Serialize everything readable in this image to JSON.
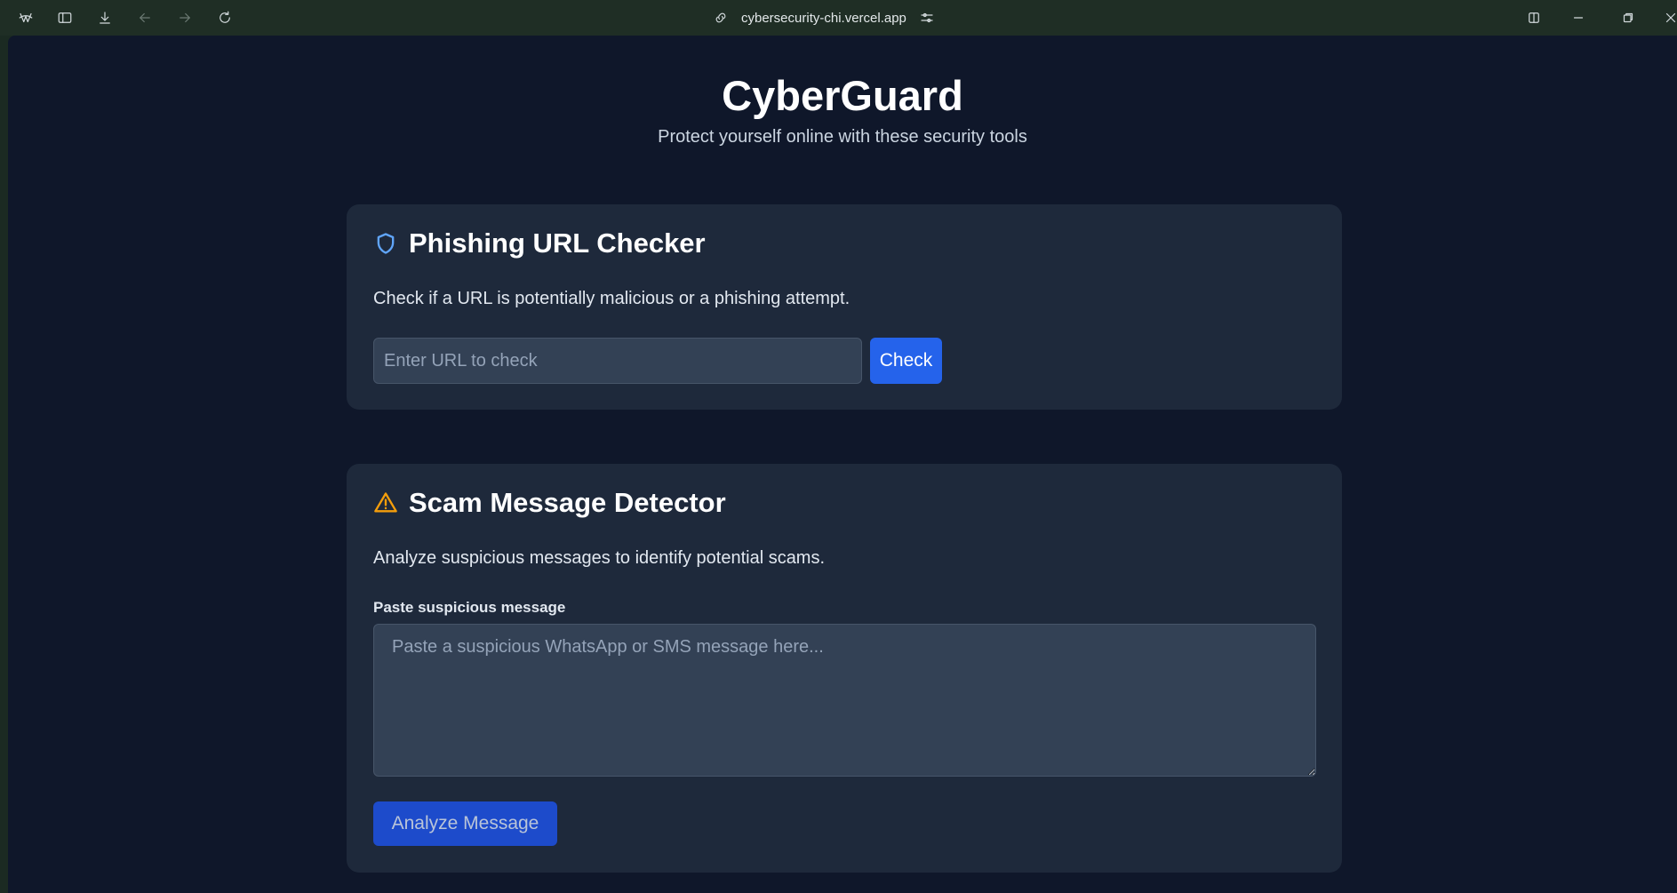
{
  "browser": {
    "url": "cybersecurity-chi.vercel.app",
    "icons": [
      "app-logo-icon",
      "sidebar-toggle-icon",
      "download-icon",
      "back-arrow-icon",
      "forward-arrow-icon",
      "reload-icon",
      "link-icon",
      "site-settings-icon",
      "split-view-icon",
      "minimize-icon",
      "restore-icon",
      "close-icon"
    ]
  },
  "header": {
    "title": "CyberGuard",
    "subtitle": "Protect yourself online with these security tools"
  },
  "phishing": {
    "icon": "shield-icon",
    "title": "Phishing URL Checker",
    "description": "Check if a URL is potentially malicious or a phishing attempt.",
    "input_placeholder": "Enter URL to check",
    "input_value": "",
    "button_label": "Check"
  },
  "scam": {
    "icon": "warning-triangle-icon",
    "title": "Scam Message Detector",
    "description": "Analyze suspicious messages to identify potential scams.",
    "field_label": "Paste suspicious message",
    "textarea_placeholder": "Paste a suspicious WhatsApp or SMS message here...",
    "textarea_value": "",
    "button_label": "Analyze Message"
  },
  "colors": {
    "page_bg": "#0f172a",
    "card_bg": "#1e293b",
    "input_bg": "#334155",
    "accent_blue": "#2563eb",
    "shield_blue": "#60a5fa",
    "warning_amber": "#f59e0b"
  }
}
